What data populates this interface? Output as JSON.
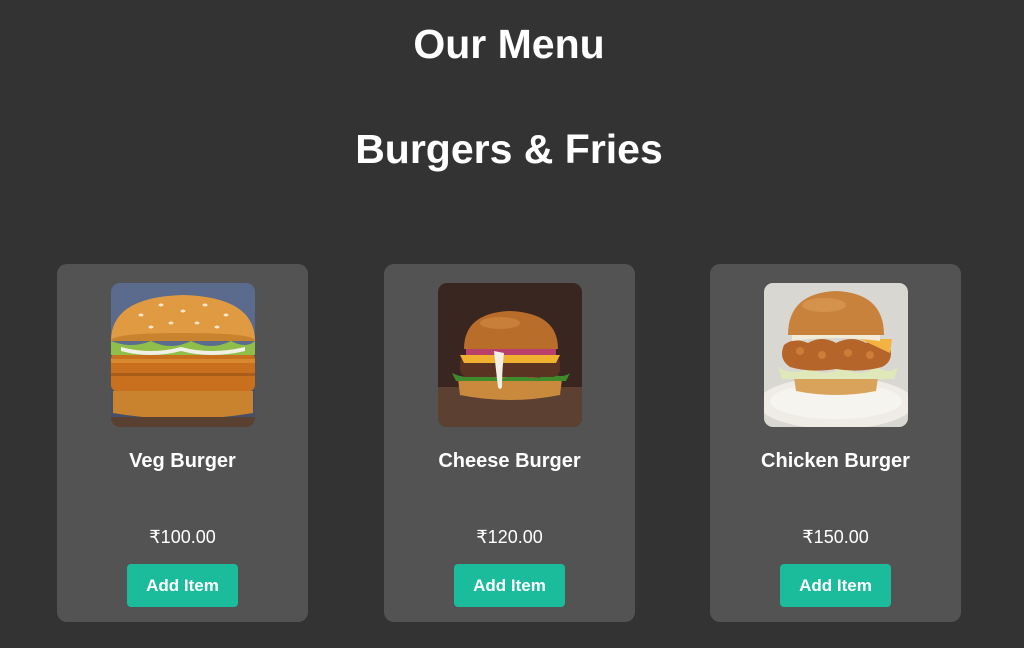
{
  "header": {
    "title": "Our Menu"
  },
  "section": {
    "title": "Burgers & Fries"
  },
  "theme": {
    "background": "#333333",
    "card_background": "#535353",
    "accent": "#1abc9c"
  },
  "items": [
    {
      "name": "Veg Burger",
      "price": "₹100.00",
      "button_label": "Add Item",
      "image": "veg-burger-image"
    },
    {
      "name": "Cheese Burger",
      "price": "₹120.00",
      "button_label": "Add Item",
      "image": "cheese-burger-image"
    },
    {
      "name": "Chicken Burger",
      "price": "₹150.00",
      "button_label": "Add Item",
      "image": "chicken-burger-image"
    }
  ]
}
